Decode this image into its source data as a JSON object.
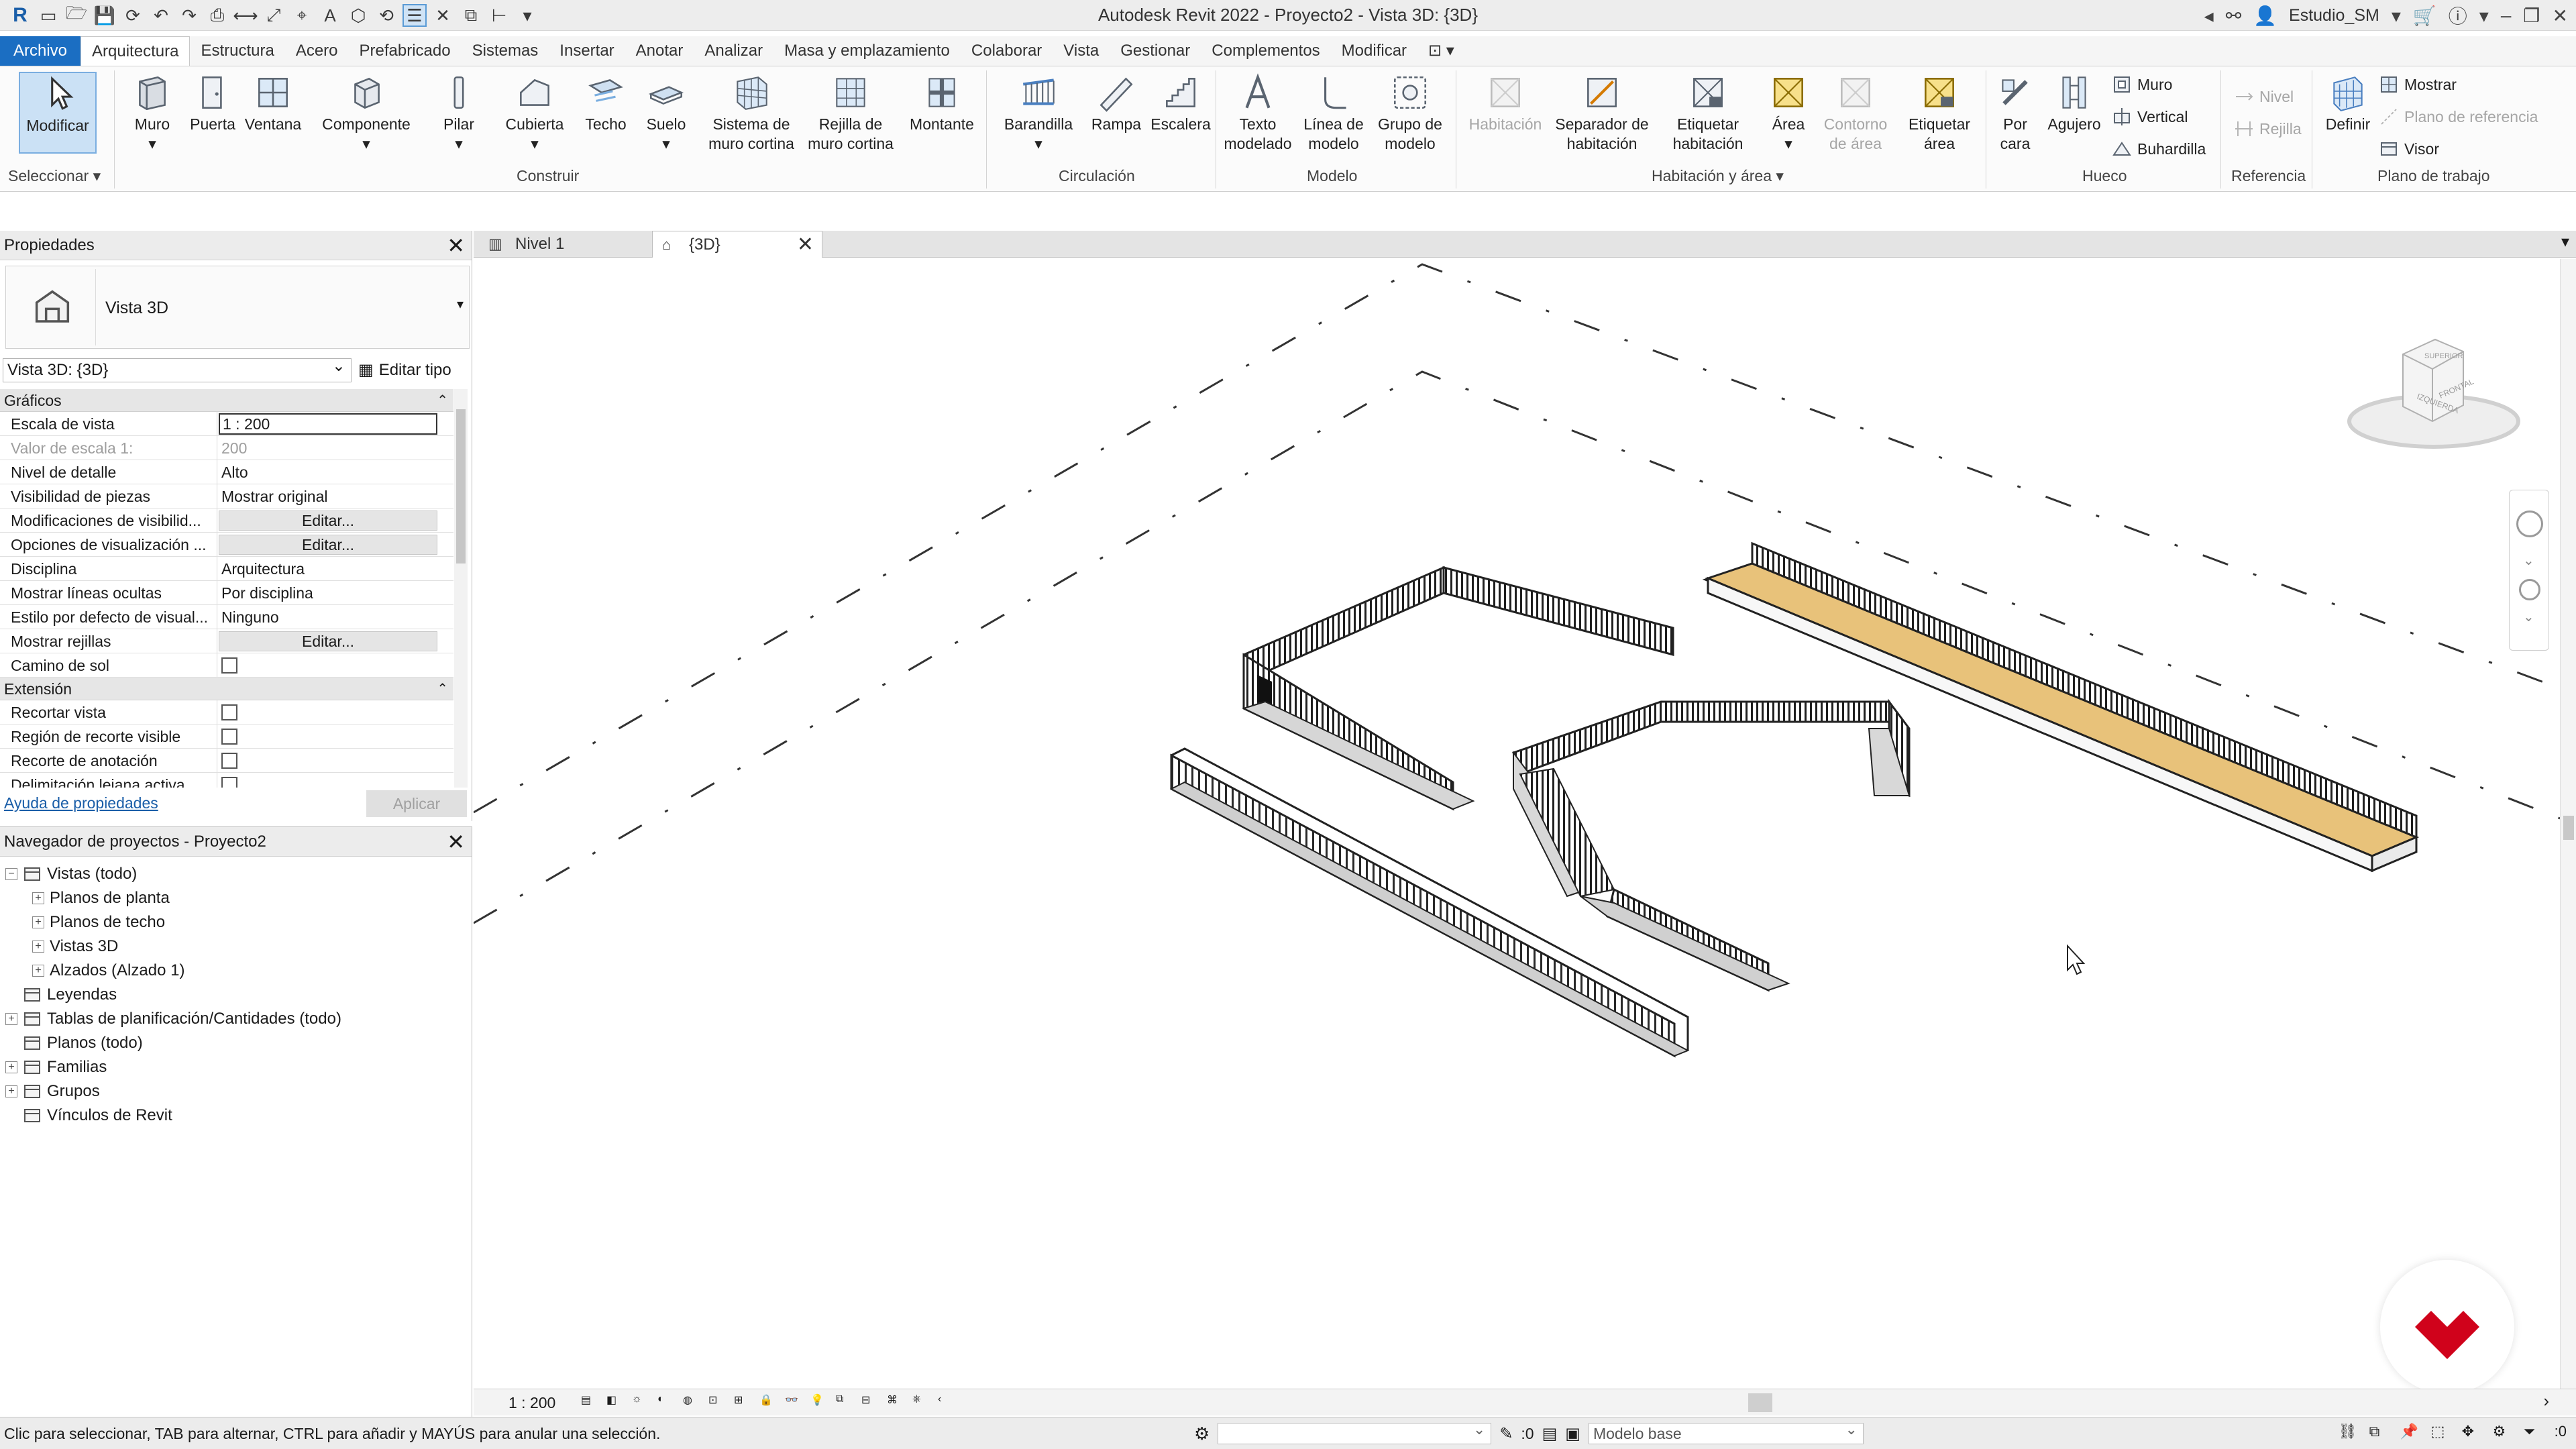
{
  "window": {
    "title": "Autodesk Revit 2022 - Proyecto2 - Vista 3D: {3D}",
    "user": "Estudio_SM"
  },
  "tabs": [
    "Archivo",
    "Arquitectura",
    "Estructura",
    "Acero",
    "Prefabricado",
    "Sistemas",
    "Insertar",
    "Anotar",
    "Analizar",
    "Masa y emplazamiento",
    "Colaborar",
    "Vista",
    "Gestionar",
    "Complementos",
    "Modificar"
  ],
  "ribbon": {
    "modificar": "Modificar",
    "seleccionar": "Seleccionar ▾",
    "construir": {
      "label": "Construir",
      "muro": "Muro",
      "puerta": "Puerta",
      "ventana": "Ventana",
      "componente": "Componente",
      "pilar": "Pilar",
      "cubierta": "Cubierta",
      "techo": "Techo",
      "suelo": "Suelo",
      "sistema_muro": "Sistema de muro cortina",
      "rejilla_muro": "Rejilla de muro cortina",
      "montante": "Montante"
    },
    "circulacion": {
      "label": "Circulación",
      "barandilla": "Barandilla",
      "rampa": "Rampa",
      "escalera": "Escalera"
    },
    "modelo": {
      "label": "Modelo",
      "texto": "Texto modelado",
      "linea": "Línea de modelo",
      "grupo": "Grupo de modelo"
    },
    "habitacion": {
      "label": "Habitación y área ▾",
      "habitacion": "Habitación",
      "separador": "Separador de habitación",
      "etiquetar_hab": "Etiquetar habitación",
      "area": "Área",
      "contorno": "Contorno de área",
      "etiquetar_area": "Etiquetar área"
    },
    "hueco": {
      "label": "Hueco",
      "por_cara": "Por cara",
      "agujero": "Agujero",
      "muro": "Muro",
      "vertical": "Vertical",
      "buhardilla": "Buhardilla"
    },
    "referencia": {
      "label": "Referencia",
      "nivel": "Nivel",
      "rejilla": "Rejilla"
    },
    "plano_trabajo": {
      "label": "Plano de trabajo",
      "definir": "Definir",
      "mostrar": "Mostrar",
      "plano_ref": "Plano de referencia",
      "visor": "Visor"
    }
  },
  "properties": {
    "title": "Propiedades",
    "type_name": "Vista 3D",
    "instance": "Vista 3D: {3D}",
    "edit_type": "Editar tipo",
    "groups": [
      {
        "name": "Gráficos",
        "rows": [
          {
            "k": "Escala de vista",
            "v": "1 : 200",
            "kind": "input"
          },
          {
            "k": "Valor de escala    1:",
            "v": "200",
            "kind": "dim"
          },
          {
            "k": "Nivel de detalle",
            "v": "Alto",
            "kind": "text"
          },
          {
            "k": "Visibilidad de piezas",
            "v": "Mostrar original",
            "kind": "text"
          },
          {
            "k": "Modificaciones de visibilid...",
            "v": "Editar...",
            "kind": "button"
          },
          {
            "k": "Opciones de visualización ...",
            "v": "Editar...",
            "kind": "button"
          },
          {
            "k": "Disciplina",
            "v": "Arquitectura",
            "kind": "text"
          },
          {
            "k": "Mostrar líneas ocultas",
            "v": "Por disciplina",
            "kind": "text"
          },
          {
            "k": "Estilo por defecto de visual...",
            "v": "Ninguno",
            "kind": "text"
          },
          {
            "k": "Mostrar rejillas",
            "v": "Editar...",
            "kind": "button"
          },
          {
            "k": "Camino de sol",
            "v": "",
            "kind": "check"
          }
        ]
      },
      {
        "name": "Extensión",
        "rows": [
          {
            "k": "Recortar vista",
            "v": "",
            "kind": "check"
          },
          {
            "k": "Región de recorte visible",
            "v": "",
            "kind": "check"
          },
          {
            "k": "Recorte de anotación",
            "v": "",
            "kind": "check"
          },
          {
            "k": "Delimitación lejana activa",
            "v": "",
            "kind": "check"
          }
        ]
      }
    ],
    "help": "Ayuda de propiedades",
    "apply": "Aplicar"
  },
  "browser": {
    "title": "Navegador de proyectos - Proyecto2",
    "items": [
      {
        "label": "Vistas (todo)",
        "level": 0,
        "exp": "−"
      },
      {
        "label": "Planos de planta",
        "level": 1,
        "exp": "+"
      },
      {
        "label": "Planos de techo",
        "level": 1,
        "exp": "+"
      },
      {
        "label": "Vistas 3D",
        "level": 1,
        "exp": "+"
      },
      {
        "label": "Alzados (Alzado 1)",
        "level": 1,
        "exp": "+"
      },
      {
        "label": "Leyendas",
        "level": 0,
        "exp": ""
      },
      {
        "label": "Tablas de planificación/Cantidades (todo)",
        "level": 0,
        "exp": "+"
      },
      {
        "label": "Planos (todo)",
        "level": 0,
        "exp": ""
      },
      {
        "label": "Familias",
        "level": 0,
        "exp": "+"
      },
      {
        "label": "Grupos",
        "level": 0,
        "exp": "+"
      },
      {
        "label": "Vínculos de Revit",
        "level": 0,
        "exp": ""
      }
    ]
  },
  "views": {
    "tab1": "Nivel 1",
    "tab2": "{3D}"
  },
  "viewcube": {
    "face1": "IZQUIERDA",
    "face2": "FRONTAL",
    "face3": "SUPERIOR"
  },
  "viewctrl": {
    "scale": "1 : 200"
  },
  "status": {
    "text": "Clic para seleccionar, TAB para alternar, CTRL para añadir y MAYÚS para anular una selección.",
    "zero1": ":0",
    "model": "Modelo base",
    "zero2": ":0"
  },
  "colors": {
    "accent": "#1b6ec2",
    "floor": "#e8c27a",
    "logo": "#d0021b"
  }
}
